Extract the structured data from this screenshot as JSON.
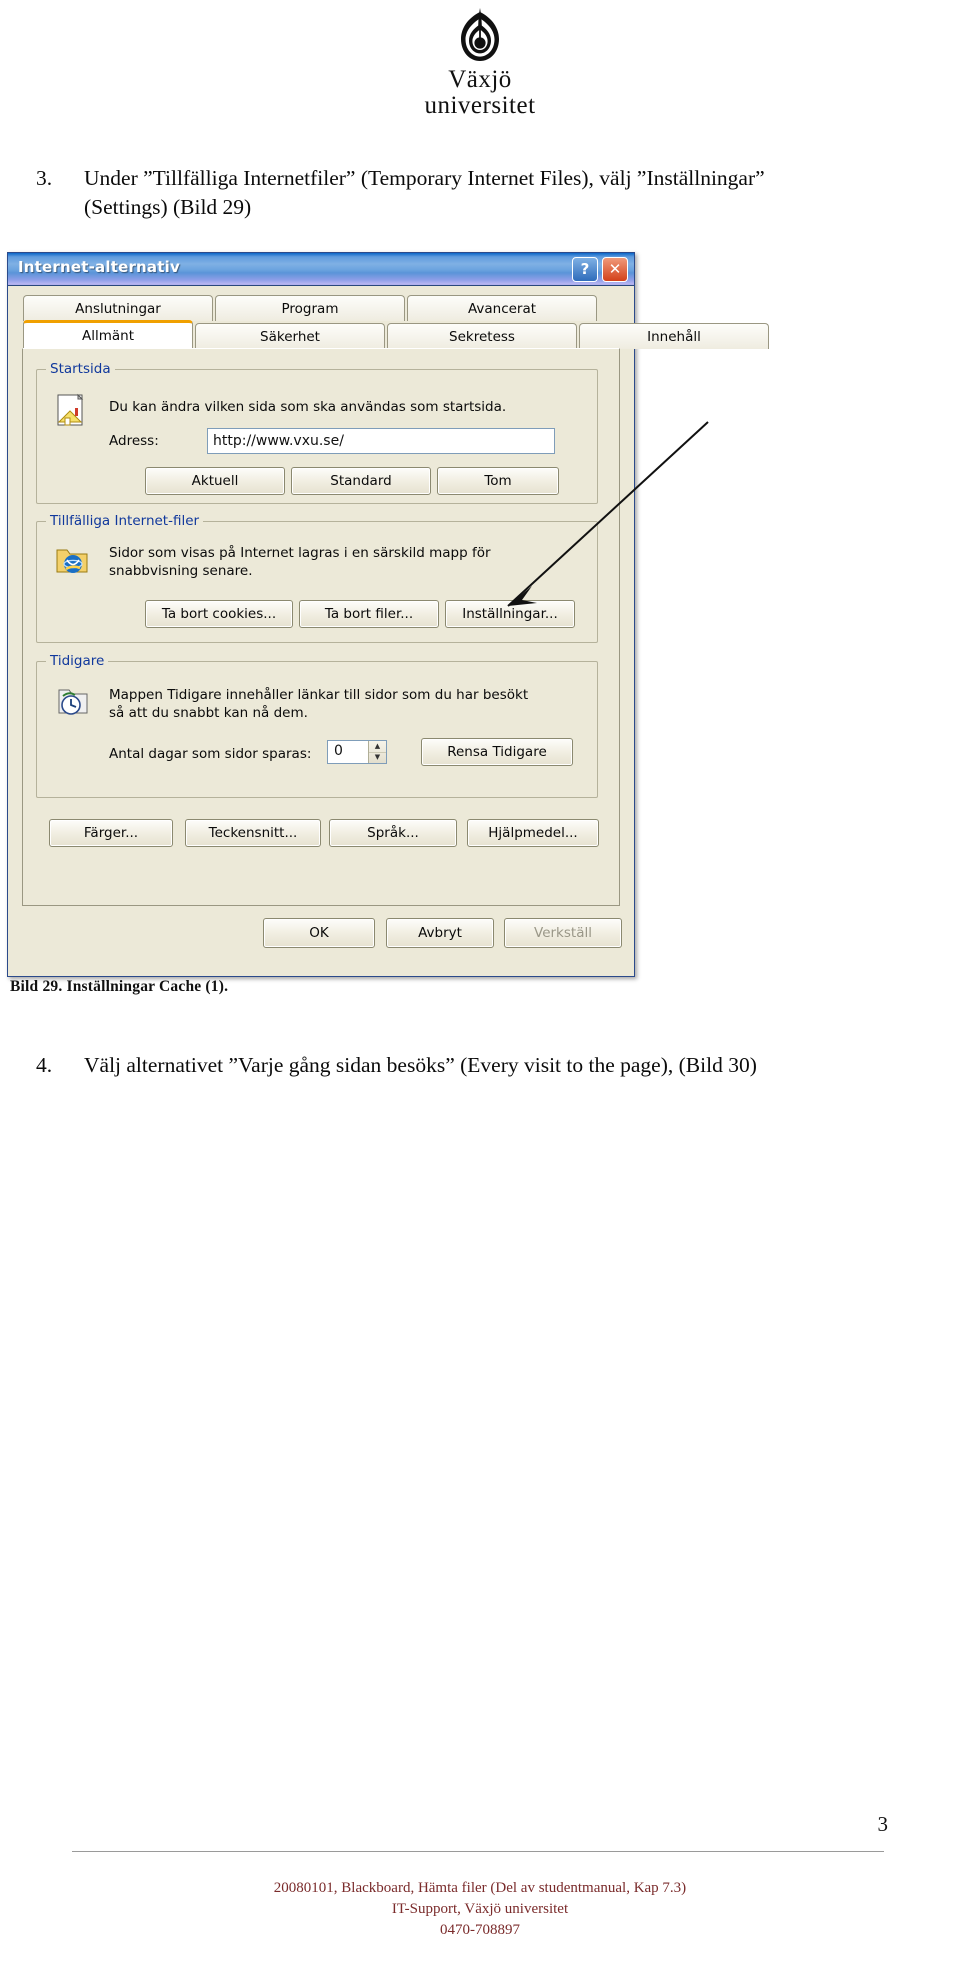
{
  "logo": {
    "crest_icon": "vaxjo-university-crest",
    "line1": "Växjö",
    "line2": "universitet"
  },
  "steps": [
    {
      "number": "3.",
      "text": "Under ”Tillfälliga Internetfiler” (Temporary Internet Files), välj ”Inställningar” (Settings) (Bild 29)"
    },
    {
      "number": "4.",
      "text": "Välj  alternativet ”Varje gång sidan besöks” (Every visit to the page), (Bild 30)"
    }
  ],
  "caption": "Bild 29. Inställningar Cache (1).",
  "dialog": {
    "title": "Internet-alternativ",
    "titlebar_buttons": [
      {
        "name": "help",
        "glyph": "?"
      },
      {
        "name": "close",
        "glyph": "✕"
      }
    ],
    "tabs_top": [
      "Anslutningar",
      "Program",
      "Avancerat"
    ],
    "tabs_bottom": [
      "Allmänt",
      "Säkerhet",
      "Sekretess",
      "Innehåll"
    ],
    "active_tab": "Allmänt",
    "groups": {
      "startsida": {
        "legend": "Startsida",
        "icon": "home-page-icon",
        "description": "Du kan ändra vilken sida som ska användas som startsida.",
        "address_label": "Adress:",
        "address_value": "http://www.vxu.se/",
        "buttons": [
          "Aktuell",
          "Standard",
          "Tom"
        ]
      },
      "temp_files": {
        "legend": "Tillfälliga Internet-filer",
        "icon": "temp-internet-files-icon",
        "description_line1": "Sidor som visas på Internet lagras i en särskild mapp för",
        "description_line2": "snabbvisning senare.",
        "buttons": [
          "Ta bort cookies...",
          "Ta bort filer...",
          "Inställningar..."
        ]
      },
      "history": {
        "legend": "Tidigare",
        "icon": "history-folder-icon",
        "description_line1": "Mappen Tidigare innehåller länkar till sidor som du har besökt",
        "description_line2": "så att du snabbt kan nå dem.",
        "days_label": "Antal dagar som sidor sparas:",
        "days_value": "0",
        "clear_button": "Rensa Tidigare"
      }
    },
    "bottom_row_buttons": [
      "Färger...",
      "Teckensnitt...",
      "Språk...",
      "Hjälpmedel..."
    ],
    "action_buttons": [
      {
        "label": "OK",
        "disabled": false
      },
      {
        "label": "Avbryt",
        "disabled": false
      },
      {
        "label": "Verkställ",
        "disabled": true
      }
    ]
  },
  "annotation": {
    "arrow_icon": "pointer-arrow"
  },
  "footer": {
    "page_number": "3",
    "line1": "20080101, Blackboard, Hämta filer (Del av studentmanual, Kap 7.3)",
    "line2": "IT-Support, Växjö universitet",
    "line3": "0470-708897"
  },
  "colors": {
    "titlebar_blue": "#5f9bdd",
    "dialog_face": "#ece9d8",
    "legend_blue": "#10389c",
    "active_tab_accent": "#f0a000",
    "footer_maroon": "#7a2b2b"
  }
}
